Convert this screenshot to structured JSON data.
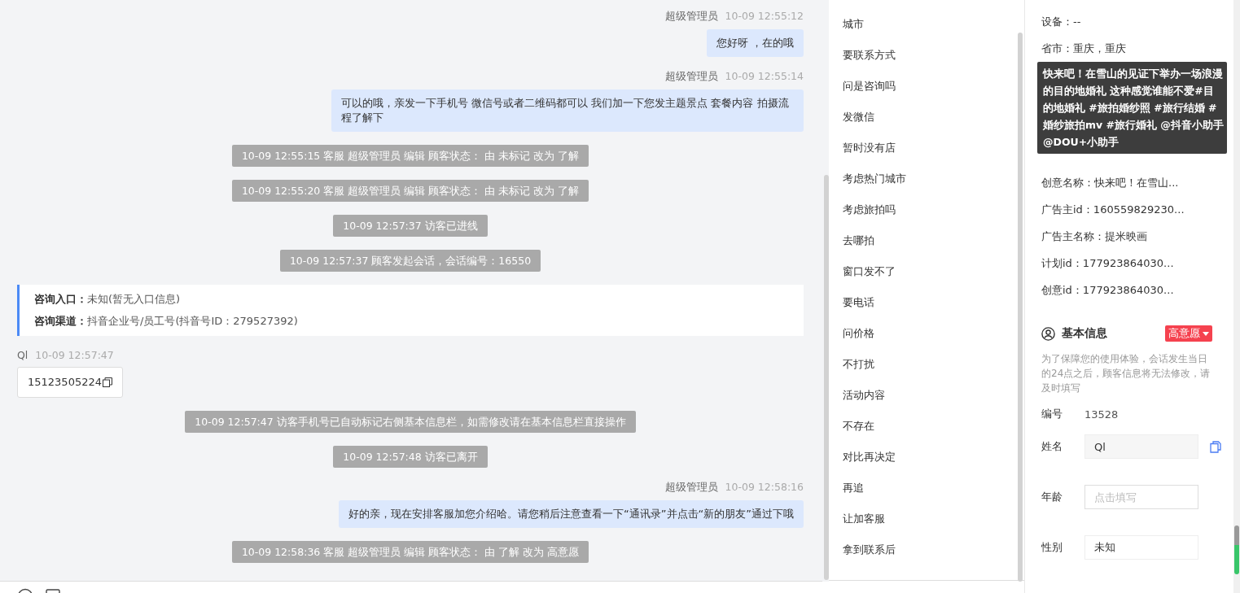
{
  "chat": {
    "messages": [
      {
        "kind": "agent",
        "sender": "超级管理员",
        "time": "10-09 12:55:12",
        "text": "您好呀 ，在的哦"
      },
      {
        "kind": "agent",
        "sender": "超级管理员",
        "time": "10-09 12:55:14",
        "text": "可以的哦，亲发一下手机号 微信号或者二维码都可以 我们加一下您发主题景点 套餐内容 拍摄流程了解下"
      },
      {
        "kind": "notice",
        "text": "10-09 12:55:15 客服 超级管理员 编辑 顾客状态： 由 未标记 改为 了解"
      },
      {
        "kind": "notice",
        "text": "10-09 12:55:20 客服 超级管理员 编辑 顾客状态： 由 未标记 改为 了解"
      },
      {
        "kind": "notice",
        "text": "10-09 12:57:37 访客已进线"
      },
      {
        "kind": "notice",
        "text": "10-09 12:57:37 顾客发起会话，会话编号：16550"
      },
      {
        "kind": "entry_card",
        "lines": [
          {
            "label": "咨询入口：",
            "value": "未知(暂无入口信息)"
          },
          {
            "label": "咨询渠道：",
            "value": "抖音企业号/员工号(抖音号ID：279527392)"
          }
        ]
      },
      {
        "kind": "visitor",
        "sender": "Ql",
        "time": "10-09 12:57:47",
        "text": "15123505224"
      },
      {
        "kind": "notice",
        "text": "10-09 12:57:47 访客手机号已自动标记右侧基本信息栏，如需修改请在基本信息栏直接操作"
      },
      {
        "kind": "notice",
        "text": "10-09 12:57:48 访客已离开"
      },
      {
        "kind": "agent",
        "sender": "超级管理员",
        "time": "10-09 12:58:16",
        "text": "好的亲，现在安排客服加您介绍哈。请您稍后注意查看一下“通讯录”并点击“新的朋友”通过下哦"
      },
      {
        "kind": "notice",
        "text": "10-09 12:58:36 客服 超级管理员 编辑 顾客状态： 由 了解 改为 高意愿"
      }
    ]
  },
  "quick_replies": [
    "城市",
    "要联系方式",
    "问是咨询吗",
    "发微信",
    "暂时没有店",
    "考虑热门城市",
    "考虑旅拍吗",
    "去哪拍",
    "窗口发不了",
    "要电话",
    "问价格",
    "不打扰",
    "活动内容",
    "不存在",
    "对比再决定",
    "再追",
    "让加客服",
    "拿到联系后"
  ],
  "source_info": {
    "rows_top": [
      "设备：--",
      "省市：重庆，重庆"
    ],
    "tooltip": "快来吧！在雪山的见证下举办一场浪漫的目的地婚礼 这种感觉谁能不爱#目的地婚礼 #旅拍婚纱照 #旅行结婚 #婚纱旅拍mv #旅行婚礼 @抖音小助手 @DOU+小助手",
    "rows_bottom": [
      "创意名称：快来吧！在雪山...",
      "广告主id：160559829230...",
      "广告主名称：提米映画",
      "计划id：177923864030...",
      "创意id：177923864030..."
    ]
  },
  "basic_info": {
    "title": "基本信息",
    "status_tag": "高意愿",
    "hint": "为了保障您的使用体验，会话发生当日的24点之后，顾客信息将无法修改，请及时填写",
    "fields": [
      {
        "kind": "text",
        "label": "编号",
        "value": "13528"
      },
      {
        "kind": "copyable",
        "label": "姓名",
        "value": "Ql"
      },
      {
        "kind": "input",
        "label": "年龄",
        "placeholder": "点击填写"
      },
      {
        "kind": "select",
        "label": "性别",
        "value": "未知"
      }
    ]
  }
}
